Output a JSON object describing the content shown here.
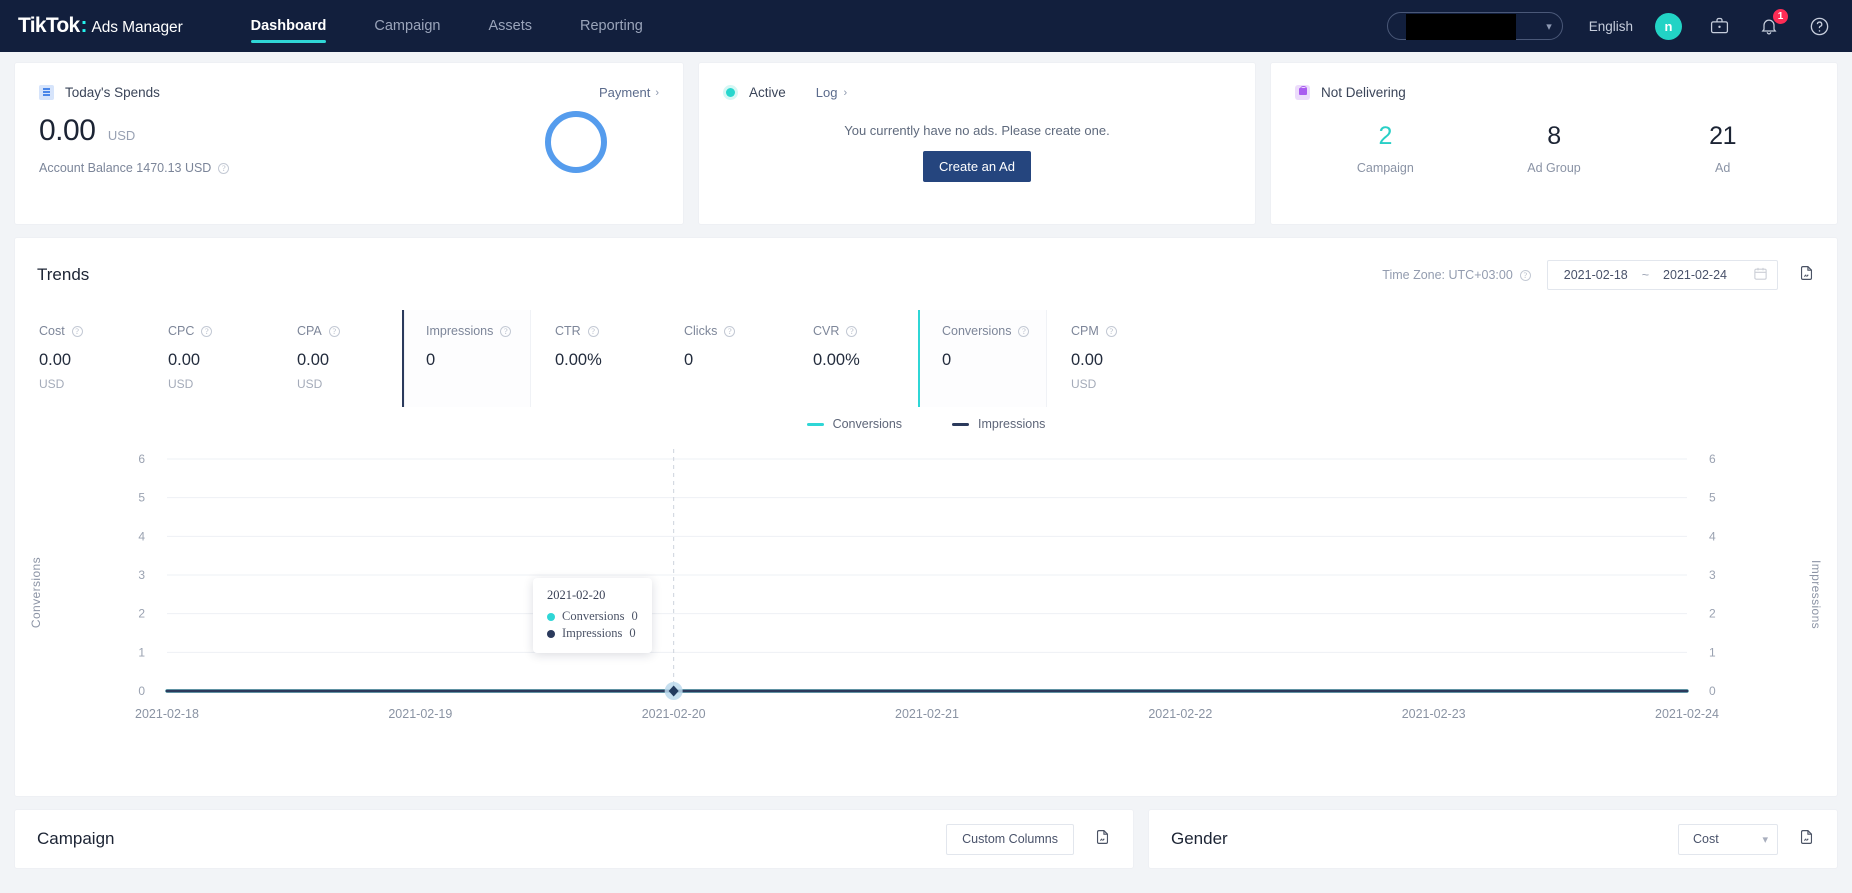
{
  "nav": {
    "brand_name": "TikTok",
    "brand_colon": ":",
    "brand_product": "Ads Manager",
    "tabs": [
      {
        "label": "Dashboard",
        "active": true
      },
      {
        "label": "Campaign",
        "active": false
      },
      {
        "label": "Assets",
        "active": false
      },
      {
        "label": "Reporting",
        "active": false
      }
    ],
    "account_selector": {
      "value": "",
      "redacted": true,
      "caret_icon": "chevron-down-icon"
    },
    "language": "English",
    "avatar_initial": "n",
    "icons": [
      {
        "name": "briefcase-icon"
      },
      {
        "name": "bell-icon",
        "badge": "1"
      },
      {
        "name": "help-icon"
      }
    ]
  },
  "spends_card": {
    "icon": "list-icon",
    "title": "Today's Spends",
    "link_label": "Payment",
    "amount": "0.00",
    "currency": "USD",
    "balance": "Account Balance 1470.13 USD",
    "info_icon": "info-icon",
    "donut_color": "#559ced"
  },
  "status_card": {
    "status_label": "Active",
    "log_label": "Log",
    "empty_message": "You currently have no ads. Please create one.",
    "create_button": "Create an Ad"
  },
  "delivery_card": {
    "title": "Not Delivering",
    "icon": "lock-icon",
    "stats": [
      {
        "value": "2",
        "label": "Campaign",
        "color": "#28cfc6"
      },
      {
        "value": "8",
        "label": "Ad Group",
        "color": "#1c2434"
      },
      {
        "value": "21",
        "label": "Ad",
        "color": "#1c2434"
      }
    ]
  },
  "trends": {
    "title": "Trends",
    "timezone": "Time Zone: UTC+03:00",
    "date_start": "2021-02-18",
    "date_sep": "~",
    "date_end": "2021-02-24",
    "calendar_icon": "calendar-icon",
    "export_icon": "export-icon",
    "metrics": [
      {
        "label": "Cost",
        "value": "0.00",
        "unit": "USD",
        "state": ""
      },
      {
        "label": "CPC",
        "value": "0.00",
        "unit": "USD",
        "state": ""
      },
      {
        "label": "CPA",
        "value": "0.00",
        "unit": "USD",
        "state": ""
      },
      {
        "label": "Impressions",
        "value": "0",
        "unit": "",
        "state": "sel-impressions"
      },
      {
        "label": "CTR",
        "value": "0.00%",
        "unit": "",
        "state": ""
      },
      {
        "label": "Clicks",
        "value": "0",
        "unit": "",
        "state": ""
      },
      {
        "label": "CVR",
        "value": "0.00%",
        "unit": "",
        "state": ""
      },
      {
        "label": "Conversions",
        "value": "0",
        "unit": "",
        "state": "sel-conversions"
      },
      {
        "label": "CPM",
        "value": "0.00",
        "unit": "USD",
        "state": ""
      }
    ],
    "tooltip": {
      "date": "2021-02-20",
      "rows": [
        {
          "label": "Conversions",
          "value": "0",
          "color": "#2fd6d6"
        },
        {
          "label": "Impressions",
          "value": "0",
          "color": "#2b3a5c"
        }
      ]
    }
  },
  "chart_data": {
    "type": "line",
    "title": "Trends",
    "xlabel": "",
    "ylabel": "Conversions",
    "y2label": "Impressions",
    "x": [
      "2021-02-18",
      "2021-02-19",
      "2021-02-20",
      "2021-02-21",
      "2021-02-22",
      "2021-02-23",
      "2021-02-24"
    ],
    "yticks": [
      0,
      1,
      2,
      3,
      4,
      5,
      6
    ],
    "y2ticks": [
      0,
      1,
      2,
      3,
      4,
      5,
      6
    ],
    "ylim": [
      0,
      6
    ],
    "y2lim": [
      0,
      6
    ],
    "grid": true,
    "legend_position": "top-center",
    "series": [
      {
        "name": "Conversions",
        "color": "#2fd6d6",
        "axis": "left",
        "values": [
          0,
          0,
          0,
          0,
          0,
          0,
          0
        ]
      },
      {
        "name": "Impressions",
        "color": "#2b3a5c",
        "axis": "right",
        "values": [
          0,
          0,
          0,
          0,
          0,
          0,
          0
        ]
      }
    ],
    "highlight_x": "2021-02-20"
  },
  "campaign_panel": {
    "title": "Campaign",
    "custom_columns": "Custom Columns",
    "export_icon": "export-icon"
  },
  "gender_panel": {
    "title": "Gender",
    "metric_select": "Cost",
    "export_icon": "export-icon"
  }
}
